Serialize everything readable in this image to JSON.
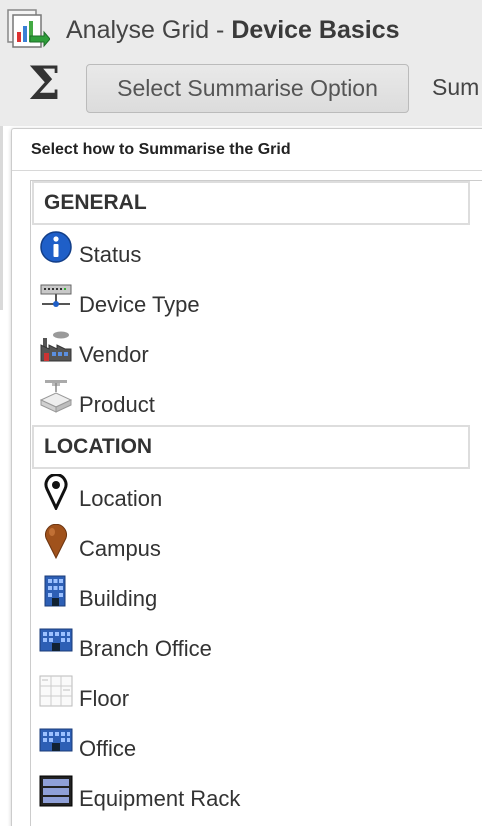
{
  "window": {
    "title_prefix": "Analyse Grid - ",
    "title_bold": "Device Basics",
    "app_icon": "analyse-grid-icon"
  },
  "toolbar": {
    "sigma_glyph": "Σ",
    "summarise_button_label": "Select Summarise Option",
    "truncated_label": "Sum"
  },
  "dropdown": {
    "header": "Select how to Summarise the Grid",
    "groups": [
      {
        "label": "GENERAL",
        "items": [
          {
            "label": "Status",
            "icon": "info-icon"
          },
          {
            "label": "Device Type",
            "icon": "network-device-icon"
          },
          {
            "label": "Vendor",
            "icon": "factory-icon"
          },
          {
            "label": "Product",
            "icon": "product-box-icon"
          }
        ]
      },
      {
        "label": "LOCATION",
        "items": [
          {
            "label": "Location",
            "icon": "location-pin-icon"
          },
          {
            "label": "Campus",
            "icon": "campus-pin-icon"
          },
          {
            "label": "Building",
            "icon": "building-icon"
          },
          {
            "label": "Branch Office",
            "icon": "branch-office-icon"
          },
          {
            "label": "Floor",
            "icon": "floor-plan-icon"
          },
          {
            "label": "Office",
            "icon": "office-icon"
          },
          {
            "label": "Equipment Rack",
            "icon": "equipment-rack-icon"
          }
        ]
      }
    ]
  },
  "colors": {
    "toolbar_bg": "#ebebeb",
    "info_blue": "#1f5fc8",
    "campus_brown": "#a0521c"
  }
}
